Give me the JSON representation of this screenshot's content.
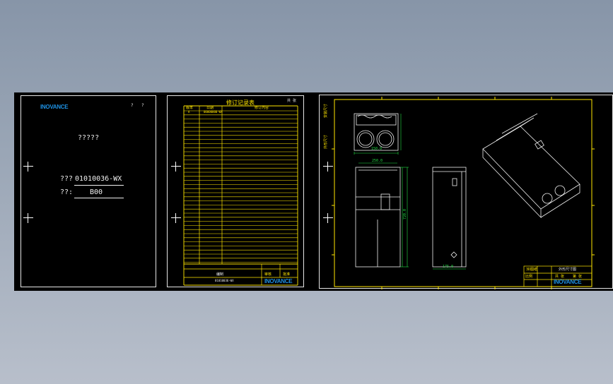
{
  "logo_text": "INOVANCE",
  "cover": {
    "page_marks": [
      "?",
      "?"
    ],
    "title": "?????",
    "code_label": "???",
    "code_value": "01010036-WX",
    "version_label": "??:",
    "version_value": "B00"
  },
  "record": {
    "title": "修订记录表",
    "header_cols": [
      "版本",
      "日期",
      "修订内容"
    ],
    "first_row": [
      "A",
      "00000000-WX"
    ],
    "sheet_no": "共 张",
    "footer_name": "编制",
    "footer_code": "01010036-WX",
    "footer_right": [
      "审核",
      "批准"
    ]
  },
  "drawing": {
    "dims": [
      "150.0",
      "220.0",
      "300.0",
      "250.0",
      "100.0",
      "720.0",
      "365.0",
      "175.0"
    ],
    "side_labels": [
      "安装尺寸",
      "外形尺寸"
    ],
    "title_block_top": "3D图纸",
    "title_block_name": "外形尺寸图",
    "title_block_cells": [
      "比例",
      "共 张",
      "第 张"
    ]
  }
}
